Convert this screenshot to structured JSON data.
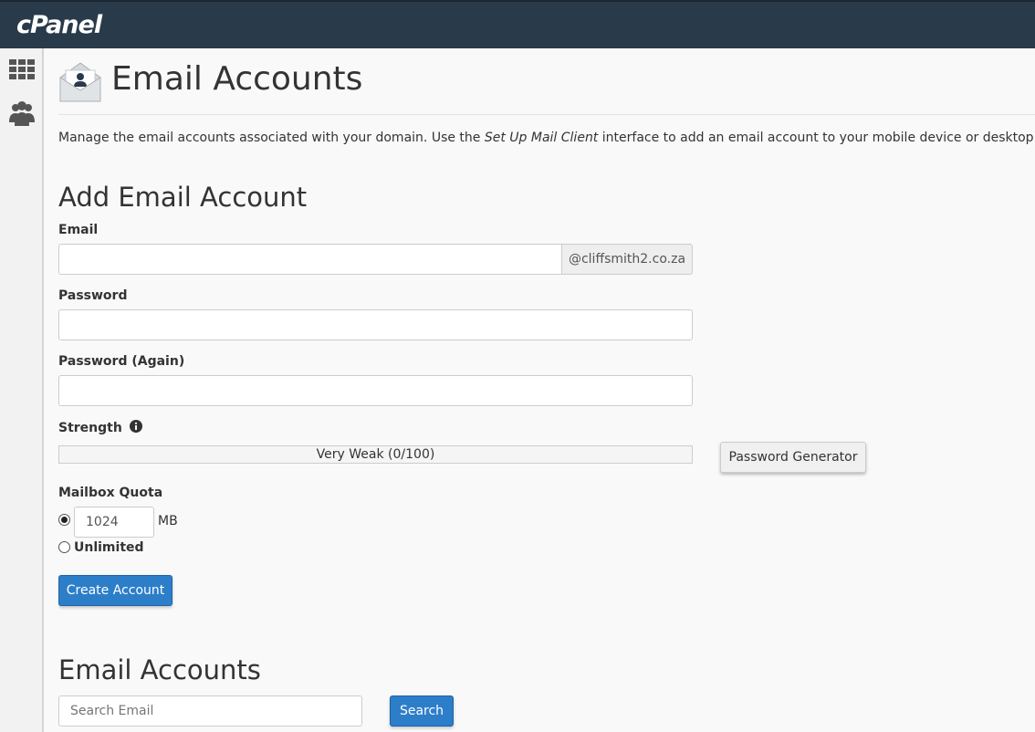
{
  "brand": {
    "logo": "cPanel"
  },
  "sidebar": {
    "items": [
      {
        "icon": "grid-icon"
      },
      {
        "icon": "users-icon"
      }
    ]
  },
  "header": {
    "title": "Email Accounts",
    "icon": "email-envelope-icon"
  },
  "description": {
    "part1": "Manage the email accounts associated with your domain. Use the ",
    "link": "Set Up Mail Client",
    "part2": " interface to add an email account to your mobile device or desktop email client. F"
  },
  "add_form": {
    "title": "Add Email Account",
    "email_label": "Email",
    "email_value": "",
    "domain": "@cliffsmith2.co.za",
    "password_label": "Password",
    "password_again_label": "Password (Again)",
    "strength_label": "Strength",
    "strength_text": "Very Weak (0/100)",
    "strength_percent": 0,
    "password_generator": "Password Generator",
    "quota_label": "Mailbox Quota",
    "quota_value": "1024",
    "quota_unit": "MB",
    "unlimited_label": "Unlimited",
    "quota_selected": "limited",
    "create_button": "Create Account"
  },
  "accounts": {
    "title": "Email Accounts",
    "search_placeholder": "Search Email",
    "search_button": "Search"
  },
  "colors": {
    "topbar": "#293a4a",
    "primary": "#2d7ec9"
  }
}
